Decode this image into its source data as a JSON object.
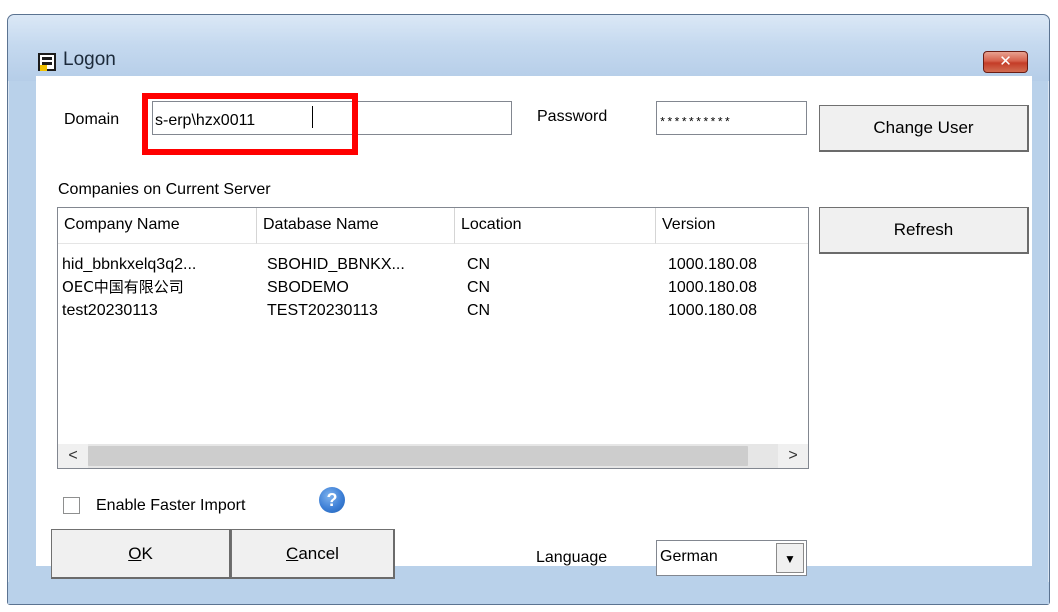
{
  "window": {
    "title": "Logon",
    "close_label": "✕"
  },
  "form": {
    "domain_label": "Domain",
    "domain_value": "s-erp\\hzx0011",
    "password_label": "Password",
    "password_value": "**********",
    "companies_label": "Companies on Current Server",
    "faster_import_label": "Enable Faster Import",
    "language_label": "Language",
    "language_value": "German"
  },
  "buttons": {
    "change_user": "Change User",
    "refresh": "Refresh",
    "ok_mnemonic": "O",
    "ok_rest": "K",
    "cancel_mnemonic": "C",
    "cancel_rest": "ancel"
  },
  "table": {
    "columns": [
      "Company Name",
      "Database Name",
      "Location",
      "Version"
    ],
    "rows": [
      [
        "hid_bbnkxelq3q2...",
        "SBOHID_BBNKX...",
        "CN",
        "1000.180.08"
      ],
      [
        "OEC中国有限公司",
        "SBODEMO",
        "CN",
        "1000.180.08"
      ],
      [
        "test20230113",
        "TEST20230113",
        "CN",
        "1000.180.08"
      ]
    ]
  },
  "icons": {
    "app": "logon-window-icon",
    "help": "question-mark-icon",
    "scroll_left": "<",
    "scroll_right": ">",
    "dropdown": "▼",
    "help_glyph": "?"
  },
  "annotation": {
    "highlight_color": "#ff0000"
  }
}
